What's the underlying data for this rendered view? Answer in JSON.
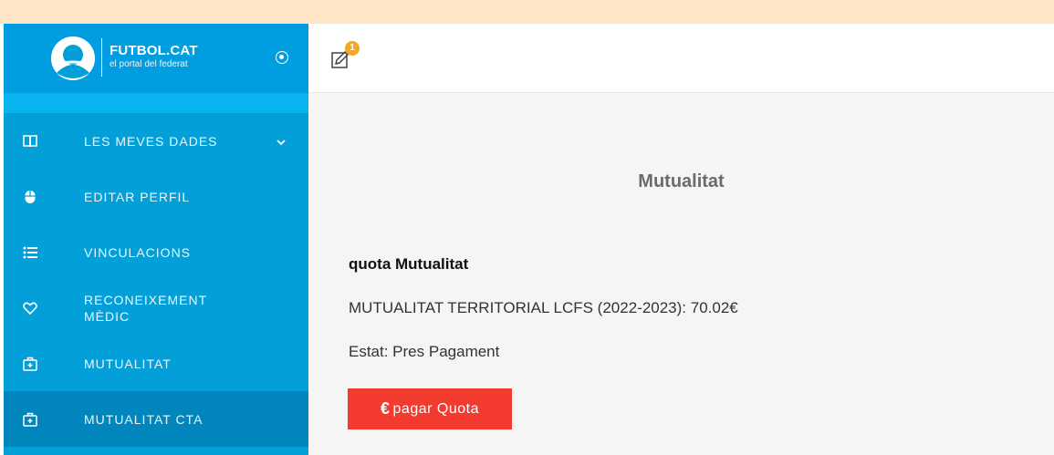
{
  "brand": {
    "name": "FUTBOL.CAT",
    "tagline": "el portal del federat"
  },
  "sidebar": {
    "items": [
      {
        "label": "LES MEVES DADES",
        "icon": "book-icon",
        "has_submenu": true
      },
      {
        "label": "EDITAR PERFIL",
        "icon": "mouse-icon"
      },
      {
        "label": "VINCULACIONS",
        "icon": "list-icon"
      },
      {
        "label": "RECONEIXEMENT MÈDIC",
        "icon": "heart-icon"
      },
      {
        "label": "MUTUALITAT",
        "icon": "medical-kit-icon"
      },
      {
        "label": "MUTUALITAT CTA",
        "icon": "medical-kit-icon",
        "active": true
      }
    ]
  },
  "topbar": {
    "notification_count": "1"
  },
  "main": {
    "page_title": "Mutualitat",
    "section_title": "quota Mutualitat",
    "detail": "MUTUALITAT TERRITORIAL LCFS (2022-2023): 70.02€",
    "status": "Estat: Pres Pagament",
    "pay_button": {
      "symbol": "€",
      "label": "pagar Quota"
    }
  },
  "colors": {
    "sidebar": "#029fd9",
    "sidebar_active": "#0185bd",
    "pay_button": "#f23a2f",
    "badge": "#f5a623",
    "top_stripe": "#fde5c6"
  }
}
